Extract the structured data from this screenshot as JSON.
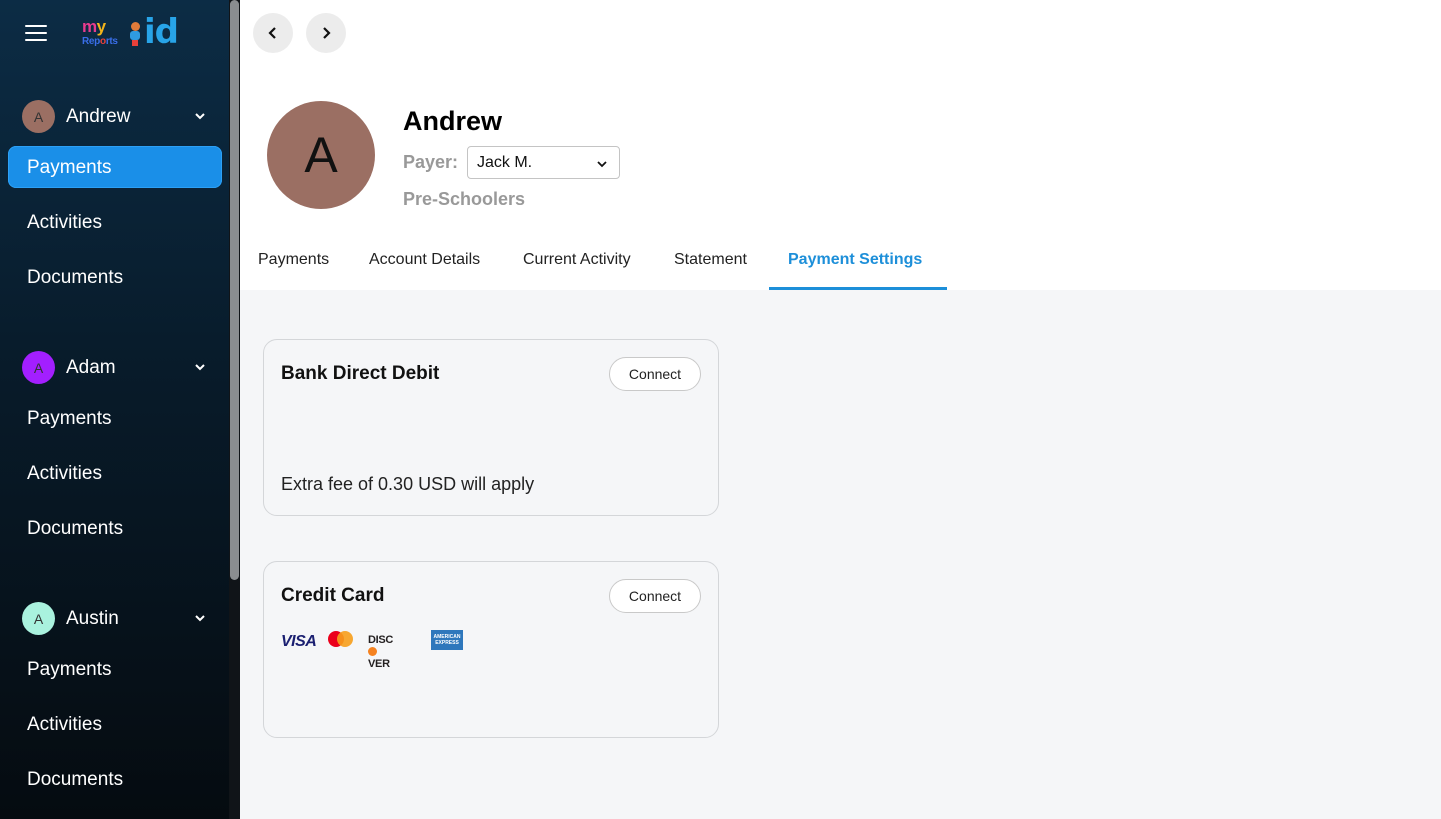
{
  "app": {
    "logo_text": "my Reports kid"
  },
  "sidebar": {
    "groups": [
      {
        "name": "Andrew",
        "initial": "A",
        "avatar_color": "#9b6f63",
        "items": [
          {
            "label": "Payments",
            "active": true
          },
          {
            "label": "Activities"
          },
          {
            "label": "Documents"
          }
        ]
      },
      {
        "name": "Adam",
        "initial": "A",
        "avatar_color": "#a31fff",
        "items": [
          {
            "label": "Payments"
          },
          {
            "label": "Activities"
          },
          {
            "label": "Documents"
          }
        ]
      },
      {
        "name": "Austin",
        "initial": "A",
        "avatar_color": "#a9f2de",
        "items": [
          {
            "label": "Payments"
          },
          {
            "label": "Activities"
          },
          {
            "label": "Documents"
          }
        ]
      }
    ]
  },
  "profile": {
    "initial": "A",
    "name": "Andrew",
    "payer_label": "Payer:",
    "payer_value": "Jack M.",
    "group": "Pre-Schoolers"
  },
  "tabs": [
    {
      "label": "Payments"
    },
    {
      "label": "Account Details"
    },
    {
      "label": "Current Activity"
    },
    {
      "label": "Statement"
    },
    {
      "label": "Payment Settings",
      "active": true
    }
  ],
  "cards": {
    "bank": {
      "title": "Bank Direct Debit",
      "button": "Connect",
      "note": "Extra fee of 0.30 USD will apply"
    },
    "credit": {
      "title": "Credit Card",
      "button": "Connect",
      "brands": {
        "visa": "VISA",
        "discover": "DISC",
        "discover_tail": "VER",
        "amex": "AMERICAN EXPRESS"
      }
    }
  },
  "colors": {
    "accent": "#1d8fd9",
    "active_nav": "#1a8fe8",
    "content_bg": "#f5f6f8"
  }
}
